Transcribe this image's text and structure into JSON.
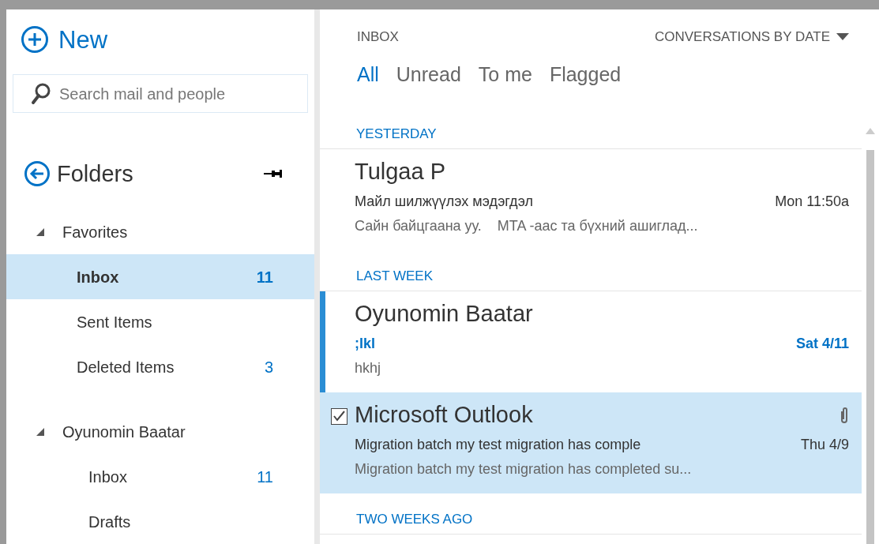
{
  "new_button": {
    "label": "New"
  },
  "search": {
    "placeholder": "Search mail and people"
  },
  "folders": {
    "title": "Folders"
  },
  "folder_groups": [
    {
      "label": "Favorites",
      "expanded": true,
      "children": [
        {
          "label": "Inbox",
          "count": "11",
          "selected": true
        },
        {
          "label": "Sent Items",
          "selected": false
        },
        {
          "label": "Deleted Items",
          "count": "3",
          "selected": false
        }
      ]
    },
    {
      "label": "Oyunomin Baatar",
      "expanded": true,
      "children": [
        {
          "label": "Inbox",
          "count": "11",
          "selected": false
        },
        {
          "label": "Drafts",
          "selected": false
        }
      ]
    }
  ],
  "list_header": {
    "folder": "INBOX",
    "sort": "CONVERSATIONS BY DATE"
  },
  "filters": [
    {
      "label": "All",
      "selected": true
    },
    {
      "label": "Unread",
      "selected": false
    },
    {
      "label": "To me",
      "selected": false
    },
    {
      "label": "Flagged",
      "selected": false
    }
  ],
  "messages": [
    {
      "kind": "header",
      "label": "YESTERDAY"
    },
    {
      "kind": "message",
      "sender": "Tulgaa P",
      "subject": "Майл шилжүүлэх мэдэгдэл",
      "preview": "Сайн байцгаана уу.    MTA -аас та бүхний ашиглад...",
      "time": "Mon 11:50a",
      "unread": false,
      "selected": false,
      "attachment": false
    },
    {
      "kind": "header",
      "label": "LAST WEEK"
    },
    {
      "kind": "message",
      "sender": "Oyunomin Baatar",
      "subject": ";lkl",
      "preview": "hkhj",
      "time": "Sat 4/11",
      "unread": true,
      "selected": false,
      "attachment": false
    },
    {
      "kind": "message",
      "sender": "Microsoft Outlook",
      "subject": "Migration batch my test migration has comple",
      "preview": "Migration batch my test migration has completed su...",
      "time": "Thu 4/9",
      "unread": false,
      "selected": true,
      "attachment": true
    },
    {
      "kind": "header",
      "label": "TWO WEEKS AGO"
    }
  ]
}
